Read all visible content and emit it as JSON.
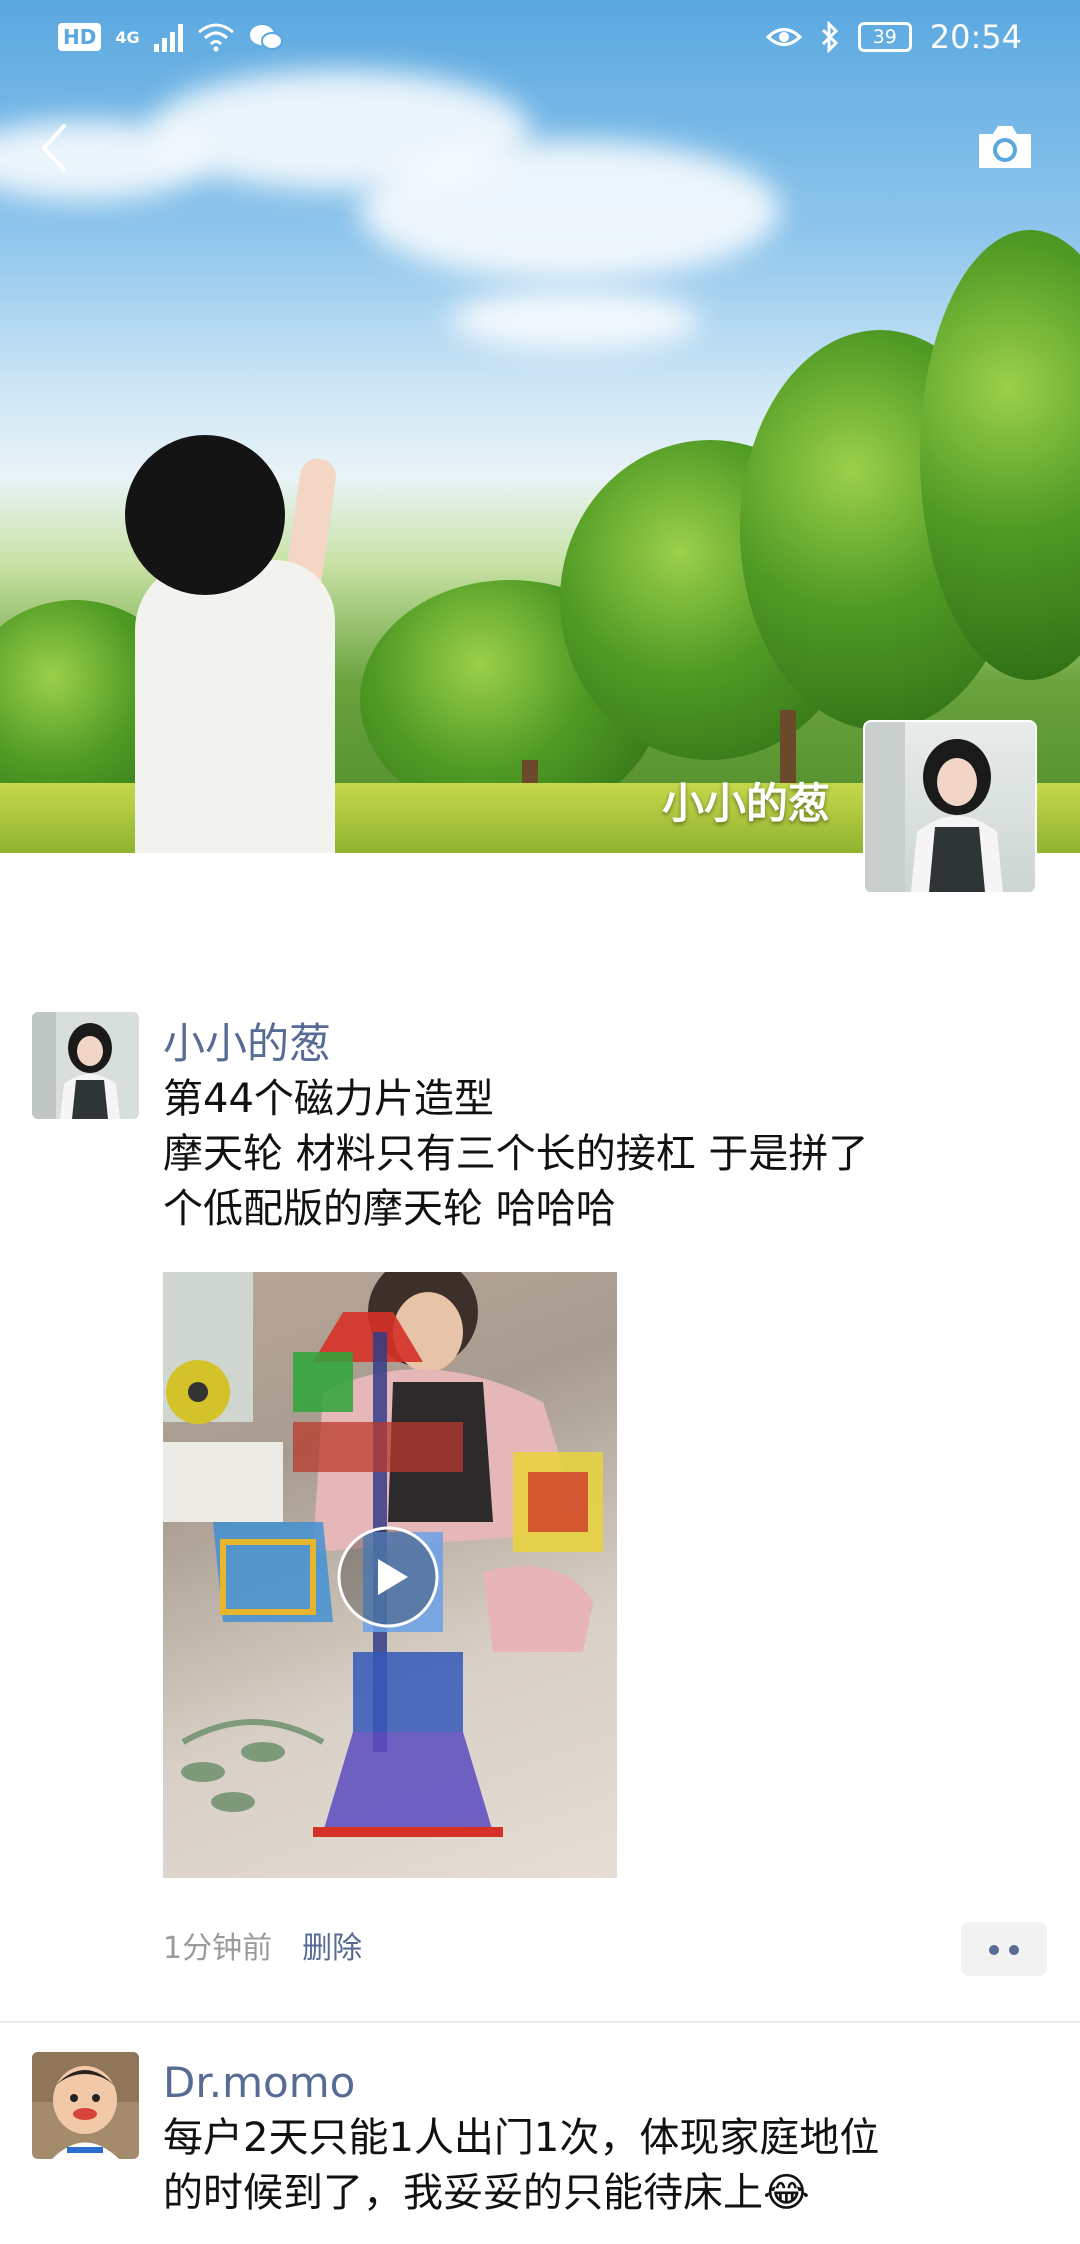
{
  "status_bar": {
    "hd": "HD",
    "network": "4G",
    "battery": "39",
    "time": "20:54"
  },
  "header": {
    "back_icon": "chevron-left-icon",
    "camera_icon": "camera-icon",
    "profile_name": "小小的葱"
  },
  "posts": [
    {
      "author": "小小的葱",
      "lines": [
        "第44个磁力片造型",
        "摩天轮  材料只有三个长的接杠 于是拼了",
        "个低配版的摩天轮 哈哈哈"
      ],
      "media": "video",
      "time": "1分钟前",
      "delete_label": "删除",
      "more_icon": "more-dots-icon"
    },
    {
      "author": "Dr.momo",
      "lines": [
        "每户2天只能1人出门1次，体现家庭地位",
        "的时候到了，我妥妥的只能待床上😂"
      ]
    }
  ]
}
